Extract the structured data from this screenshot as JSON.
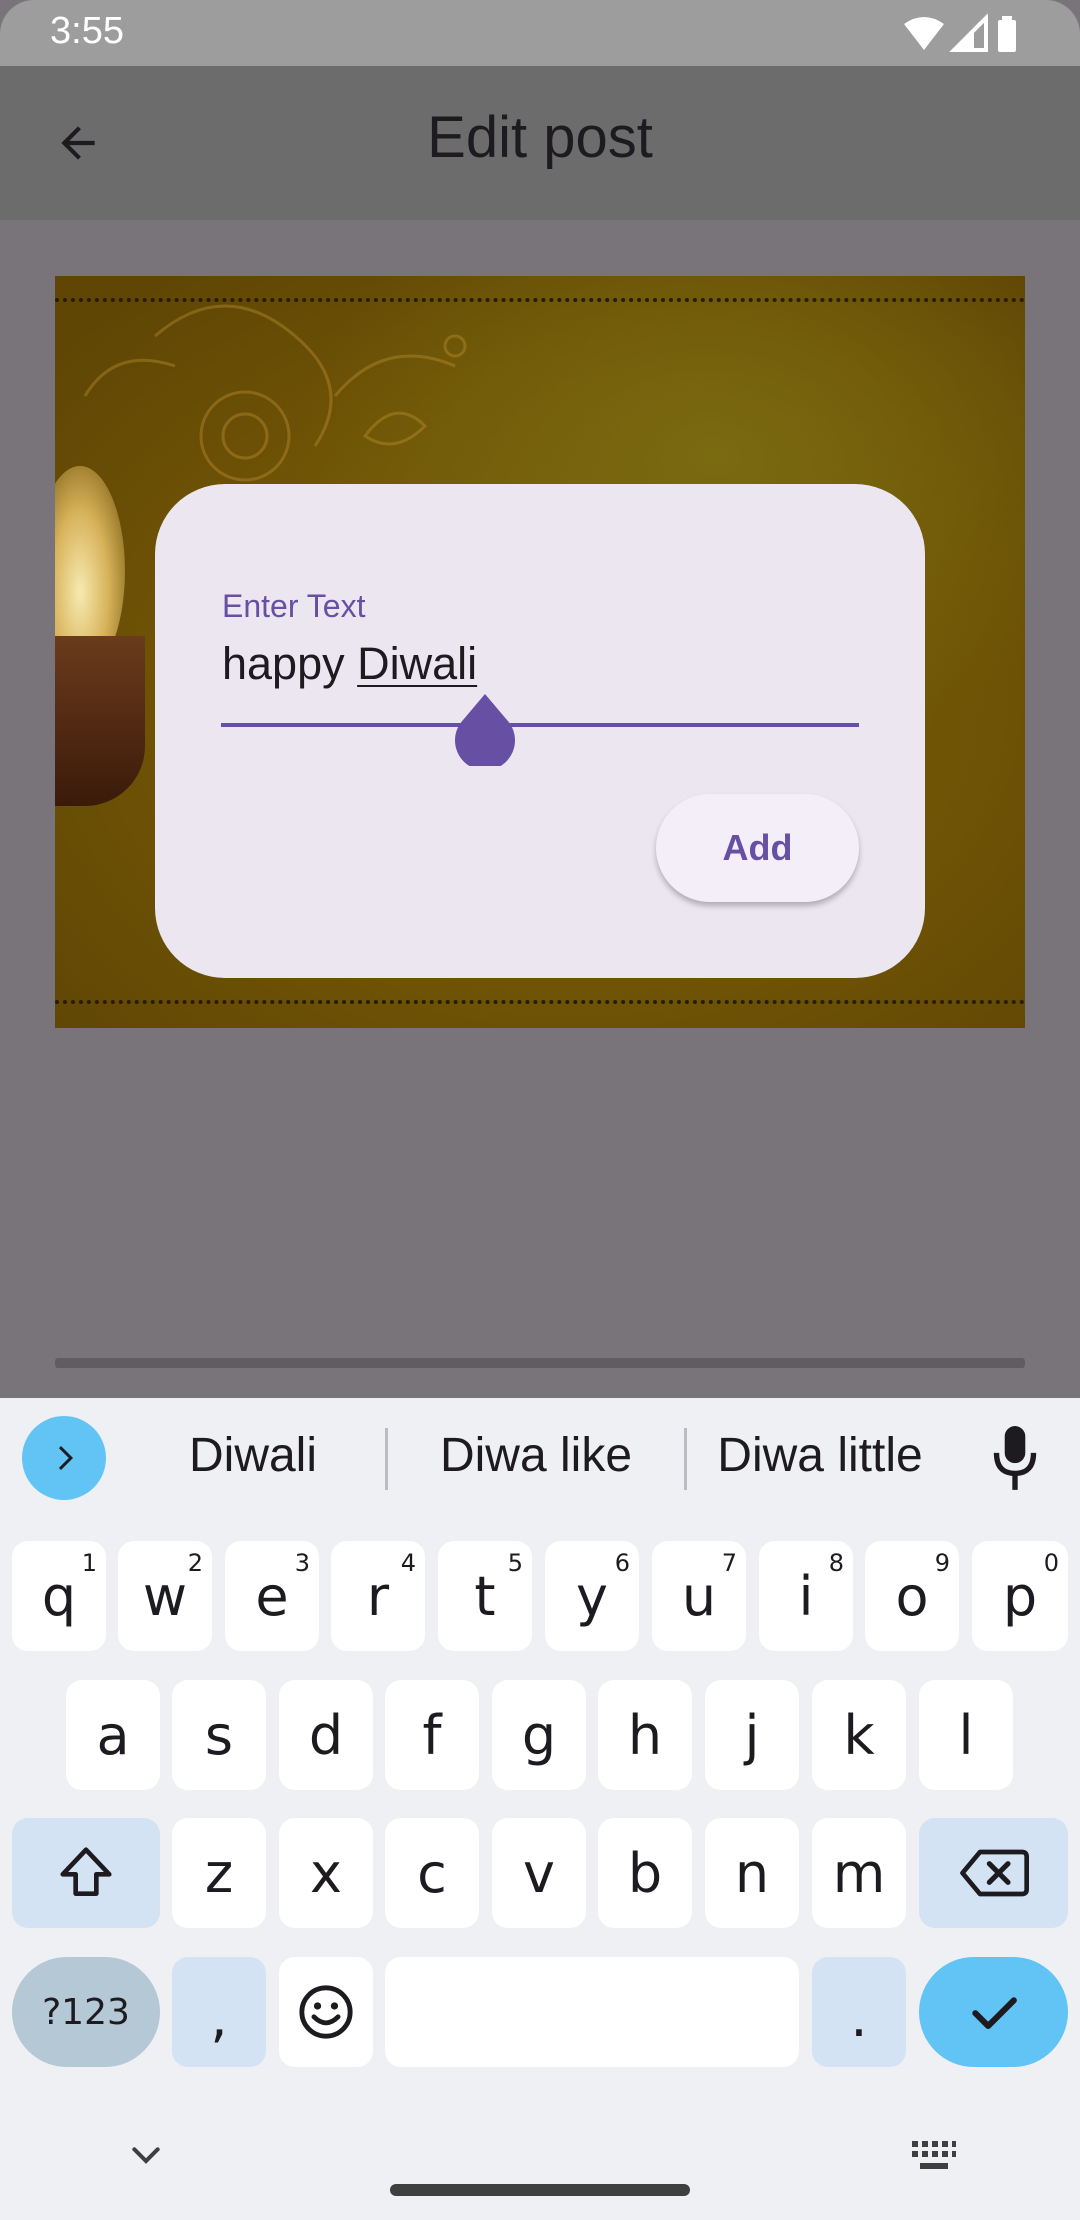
{
  "status_bar": {
    "time": "3:55",
    "icons": [
      "wifi-icon",
      "signal-icon",
      "battery-icon"
    ]
  },
  "app_bar": {
    "title": "Edit post",
    "back_icon": "arrow-back-icon"
  },
  "dialog": {
    "field_label": "Enter Text",
    "field_value_prefix": "happy ",
    "field_value_composing": "Diwali",
    "add_button": "Add"
  },
  "keyboard": {
    "suggestions": [
      "Diwali",
      "Diwa like",
      "Diwa little"
    ],
    "row1": [
      {
        "label": "q",
        "hint": "1"
      },
      {
        "label": "w",
        "hint": "2"
      },
      {
        "label": "e",
        "hint": "3"
      },
      {
        "label": "r",
        "hint": "4"
      },
      {
        "label": "t",
        "hint": "5"
      },
      {
        "label": "y",
        "hint": "6"
      },
      {
        "label": "u",
        "hint": "7"
      },
      {
        "label": "i",
        "hint": "8"
      },
      {
        "label": "o",
        "hint": "9"
      },
      {
        "label": "p",
        "hint": "0"
      }
    ],
    "row2": [
      "a",
      "s",
      "d",
      "f",
      "g",
      "h",
      "j",
      "k",
      "l"
    ],
    "row3": [
      "z",
      "x",
      "c",
      "v",
      "b",
      "n",
      "m"
    ],
    "symbols_key": "?123",
    "comma_key": ",",
    "period_key": "."
  },
  "colors": {
    "accent": "#6750a4",
    "keyboard_accent": "#62c4f5",
    "dialog_bg": "#ece6f1"
  }
}
